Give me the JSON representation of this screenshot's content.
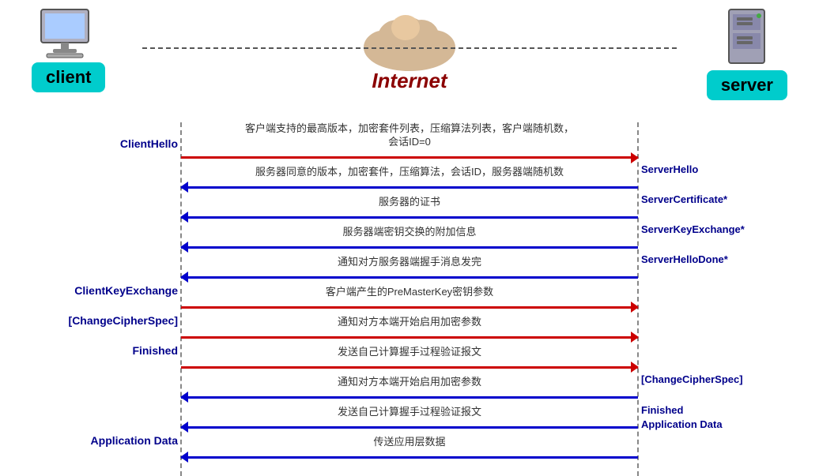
{
  "header": {
    "internet_label": "Internet",
    "client_label": "client",
    "server_label": "server"
  },
  "left_labels": {
    "clienthello": "ClientHello",
    "clientkeyexchange": "ClientKeyExchange",
    "changecipherspec": "[ChangeCipherSpec]",
    "finished": "Finished",
    "application_data": "Application Data"
  },
  "right_labels": {
    "serverhello": "ServerHello",
    "servercertificate": "ServerCertificate*",
    "serverkeyexchange": "ServerKeyExchange*",
    "serverhellodone": "ServerHelloDone*",
    "changecipherspec": "[ChangeCipherSpec]",
    "finished": "Finished",
    "application_data": "Application Data"
  },
  "messages": {
    "msg1": "客户端支持的最高版本，加密套件列表，压缩算法列表，客户端随机数，",
    "msg1b": "会话ID=0",
    "msg2": "服务器同意的版本，加密套件，压缩算法，会话ID，服务器端随机数",
    "msg3": "服务器的证书",
    "msg4": "服务器端密钥交换的附加信息",
    "msg5": "通知对方服务器端握手消息发完",
    "msg6": "客户端产生的PreMasterKey密钥参数",
    "msg7": "通知对方本端开始启用加密参数",
    "msg8": "发送自己计算握手过程验证报文",
    "msg9": "通知对方本端开始启用加密参数",
    "msg10": "发送自己计算握手过程验证报文",
    "msg11": "传送应用层数据"
  }
}
